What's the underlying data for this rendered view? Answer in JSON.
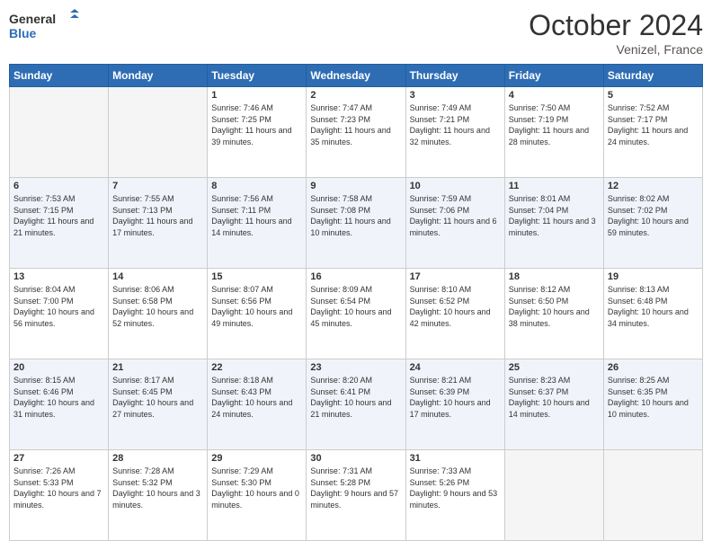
{
  "header": {
    "logo_line1": "General",
    "logo_line2": "Blue",
    "month": "October 2024",
    "location": "Venizel, France"
  },
  "days_of_week": [
    "Sunday",
    "Monday",
    "Tuesday",
    "Wednesday",
    "Thursday",
    "Friday",
    "Saturday"
  ],
  "weeks": [
    [
      {
        "day": "",
        "empty": true
      },
      {
        "day": "",
        "empty": true
      },
      {
        "day": "1",
        "sunrise": "7:46 AM",
        "sunset": "7:25 PM",
        "daylight": "11 hours and 39 minutes."
      },
      {
        "day": "2",
        "sunrise": "7:47 AM",
        "sunset": "7:23 PM",
        "daylight": "11 hours and 35 minutes."
      },
      {
        "day": "3",
        "sunrise": "7:49 AM",
        "sunset": "7:21 PM",
        "daylight": "11 hours and 32 minutes."
      },
      {
        "day": "4",
        "sunrise": "7:50 AM",
        "sunset": "7:19 PM",
        "daylight": "11 hours and 28 minutes."
      },
      {
        "day": "5",
        "sunrise": "7:52 AM",
        "sunset": "7:17 PM",
        "daylight": "11 hours and 24 minutes."
      }
    ],
    [
      {
        "day": "6",
        "sunrise": "7:53 AM",
        "sunset": "7:15 PM",
        "daylight": "11 hours and 21 minutes."
      },
      {
        "day": "7",
        "sunrise": "7:55 AM",
        "sunset": "7:13 PM",
        "daylight": "11 hours and 17 minutes."
      },
      {
        "day": "8",
        "sunrise": "7:56 AM",
        "sunset": "7:11 PM",
        "daylight": "11 hours and 14 minutes."
      },
      {
        "day": "9",
        "sunrise": "7:58 AM",
        "sunset": "7:08 PM",
        "daylight": "11 hours and 10 minutes."
      },
      {
        "day": "10",
        "sunrise": "7:59 AM",
        "sunset": "7:06 PM",
        "daylight": "11 hours and 6 minutes."
      },
      {
        "day": "11",
        "sunrise": "8:01 AM",
        "sunset": "7:04 PM",
        "daylight": "11 hours and 3 minutes."
      },
      {
        "day": "12",
        "sunrise": "8:02 AM",
        "sunset": "7:02 PM",
        "daylight": "10 hours and 59 minutes."
      }
    ],
    [
      {
        "day": "13",
        "sunrise": "8:04 AM",
        "sunset": "7:00 PM",
        "daylight": "10 hours and 56 minutes."
      },
      {
        "day": "14",
        "sunrise": "8:06 AM",
        "sunset": "6:58 PM",
        "daylight": "10 hours and 52 minutes."
      },
      {
        "day": "15",
        "sunrise": "8:07 AM",
        "sunset": "6:56 PM",
        "daylight": "10 hours and 49 minutes."
      },
      {
        "day": "16",
        "sunrise": "8:09 AM",
        "sunset": "6:54 PM",
        "daylight": "10 hours and 45 minutes."
      },
      {
        "day": "17",
        "sunrise": "8:10 AM",
        "sunset": "6:52 PM",
        "daylight": "10 hours and 42 minutes."
      },
      {
        "day": "18",
        "sunrise": "8:12 AM",
        "sunset": "6:50 PM",
        "daylight": "10 hours and 38 minutes."
      },
      {
        "day": "19",
        "sunrise": "8:13 AM",
        "sunset": "6:48 PM",
        "daylight": "10 hours and 34 minutes."
      }
    ],
    [
      {
        "day": "20",
        "sunrise": "8:15 AM",
        "sunset": "6:46 PM",
        "daylight": "10 hours and 31 minutes."
      },
      {
        "day": "21",
        "sunrise": "8:17 AM",
        "sunset": "6:45 PM",
        "daylight": "10 hours and 27 minutes."
      },
      {
        "day": "22",
        "sunrise": "8:18 AM",
        "sunset": "6:43 PM",
        "daylight": "10 hours and 24 minutes."
      },
      {
        "day": "23",
        "sunrise": "8:20 AM",
        "sunset": "6:41 PM",
        "daylight": "10 hours and 21 minutes."
      },
      {
        "day": "24",
        "sunrise": "8:21 AM",
        "sunset": "6:39 PM",
        "daylight": "10 hours and 17 minutes."
      },
      {
        "day": "25",
        "sunrise": "8:23 AM",
        "sunset": "6:37 PM",
        "daylight": "10 hours and 14 minutes."
      },
      {
        "day": "26",
        "sunrise": "8:25 AM",
        "sunset": "6:35 PM",
        "daylight": "10 hours and 10 minutes."
      }
    ],
    [
      {
        "day": "27",
        "sunrise": "7:26 AM",
        "sunset": "5:33 PM",
        "daylight": "10 hours and 7 minutes."
      },
      {
        "day": "28",
        "sunrise": "7:28 AM",
        "sunset": "5:32 PM",
        "daylight": "10 hours and 3 minutes."
      },
      {
        "day": "29",
        "sunrise": "7:29 AM",
        "sunset": "5:30 PM",
        "daylight": "10 hours and 0 minutes."
      },
      {
        "day": "30",
        "sunrise": "7:31 AM",
        "sunset": "5:28 PM",
        "daylight": "9 hours and 57 minutes."
      },
      {
        "day": "31",
        "sunrise": "7:33 AM",
        "sunset": "5:26 PM",
        "daylight": "9 hours and 53 minutes."
      },
      {
        "day": "",
        "empty": true
      },
      {
        "day": "",
        "empty": true
      }
    ]
  ],
  "labels": {
    "sunrise": "Sunrise:",
    "sunset": "Sunset:",
    "daylight": "Daylight:"
  }
}
